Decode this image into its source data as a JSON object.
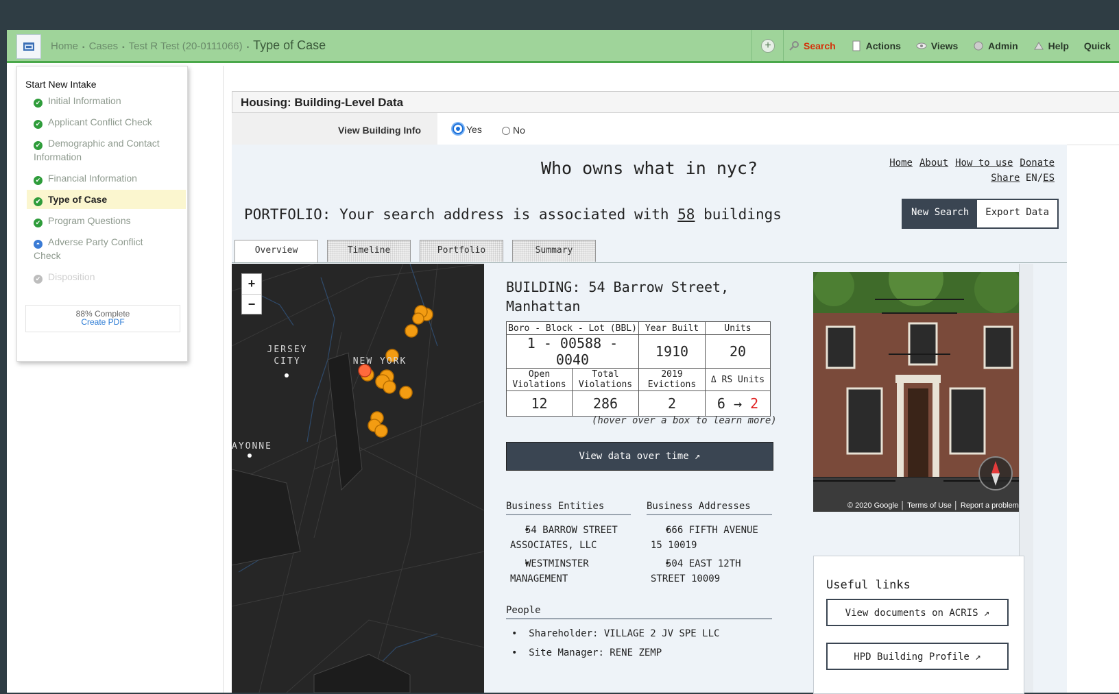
{
  "topbar": {
    "breadcrumbs": [
      "Home",
      "Cases",
      "Test R Test (20-0111066)"
    ],
    "current": "Type of Case",
    "menu": [
      {
        "label": "Search",
        "icon": "search-icon"
      },
      {
        "label": "Actions",
        "icon": "document-icon"
      },
      {
        "label": "Views",
        "icon": "eye-icon"
      },
      {
        "label": "Admin",
        "icon": "admin-icon"
      },
      {
        "label": "Help",
        "icon": "help-icon"
      },
      {
        "label": "Quick",
        "icon": ""
      }
    ]
  },
  "intake": {
    "title": "Start New Intake",
    "steps": [
      {
        "label": "Initial Information",
        "status": "done"
      },
      {
        "label": "Applicant Conflict Check",
        "status": "done"
      },
      {
        "label": "Demographic and Contact Information",
        "status": "done"
      },
      {
        "label": "Financial Information",
        "status": "done"
      },
      {
        "label": "Type of Case",
        "status": "current"
      },
      {
        "label": "Program Questions",
        "status": "done"
      },
      {
        "label": "Adverse Party Conflict Check",
        "status": "partial"
      },
      {
        "label": "Disposition",
        "status": "disabled"
      }
    ],
    "progress": "88% Complete",
    "create_pdf": "Create PDF"
  },
  "housing": {
    "header": "Housing: Building-Level Data",
    "view_label": "View Building Info",
    "yes": "Yes",
    "no": "No",
    "selected": "Yes"
  },
  "wow": {
    "title": "Who owns what in nyc?",
    "links": [
      "Home",
      "About",
      "How to use",
      "Donate"
    ],
    "share": "Share",
    "lang": "EN/",
    "lang_es": "ES",
    "portfolio_prefix": "PORTFOLIO: Your search address is associated with ",
    "portfolio_count": "58",
    "portfolio_suffix": " buildings",
    "new_search": "New Search",
    "export": "Export Data",
    "tabs": [
      "Overview",
      "Timeline",
      "Portfolio",
      "Summary"
    ],
    "active_tab": "Overview",
    "map": {
      "zoom_in": "+",
      "zoom_out": "−",
      "labels": [
        "JERSEY CITY",
        "NEW YORK",
        "AYONNE"
      ]
    },
    "building": {
      "title": "BUILDING: 54 Barrow Street, Manhattan",
      "bbl_label": "Boro - Block - Lot (BBL)",
      "bbl": "1 - 00588 - 0040",
      "year_label": "Year Built",
      "year": "1910",
      "units_label": "Units",
      "units": "20",
      "open_label": "Open Violations",
      "open": "12",
      "total_label": "Total Violations",
      "total": "286",
      "evictions_label": "2019 Evictions",
      "evictions": "2",
      "rs_label": "Δ RS Units",
      "rs_from": "6",
      "rs_arrow": "→",
      "rs_to": "2",
      "hover_note": "(hover over a box to learn more)",
      "view_data": "View data over time ↗"
    },
    "entities_h": "Business Entities",
    "entities": [
      "54 BARROW STREET ASSOCIATES, LLC",
      "WESTMINSTER MANAGEMENT"
    ],
    "addresses_h": "Business Addresses",
    "addresses": [
      "666 FIFTH AVENUE 15 10019",
      "504 EAST 12TH STREET 10009"
    ],
    "people_h": "People",
    "people": [
      "Shareholder: VILLAGE 2 JV SPE LLC",
      "Site Manager: RENE ZEMP"
    ],
    "photo_credit": "© 2020 Google",
    "photo_terms": "Terms of Use",
    "photo_report": "Report a problem",
    "useful_h": "Useful links",
    "useful": [
      "View documents on ACRIS ↗",
      "HPD Building Profile ↗"
    ]
  },
  "colors": {
    "topbar": "#9fd49a",
    "dark_button": "#3a4552",
    "check": "#2e9c3a",
    "map_marker": "#f39c12",
    "map_marker_active": "#ff6a3d"
  }
}
